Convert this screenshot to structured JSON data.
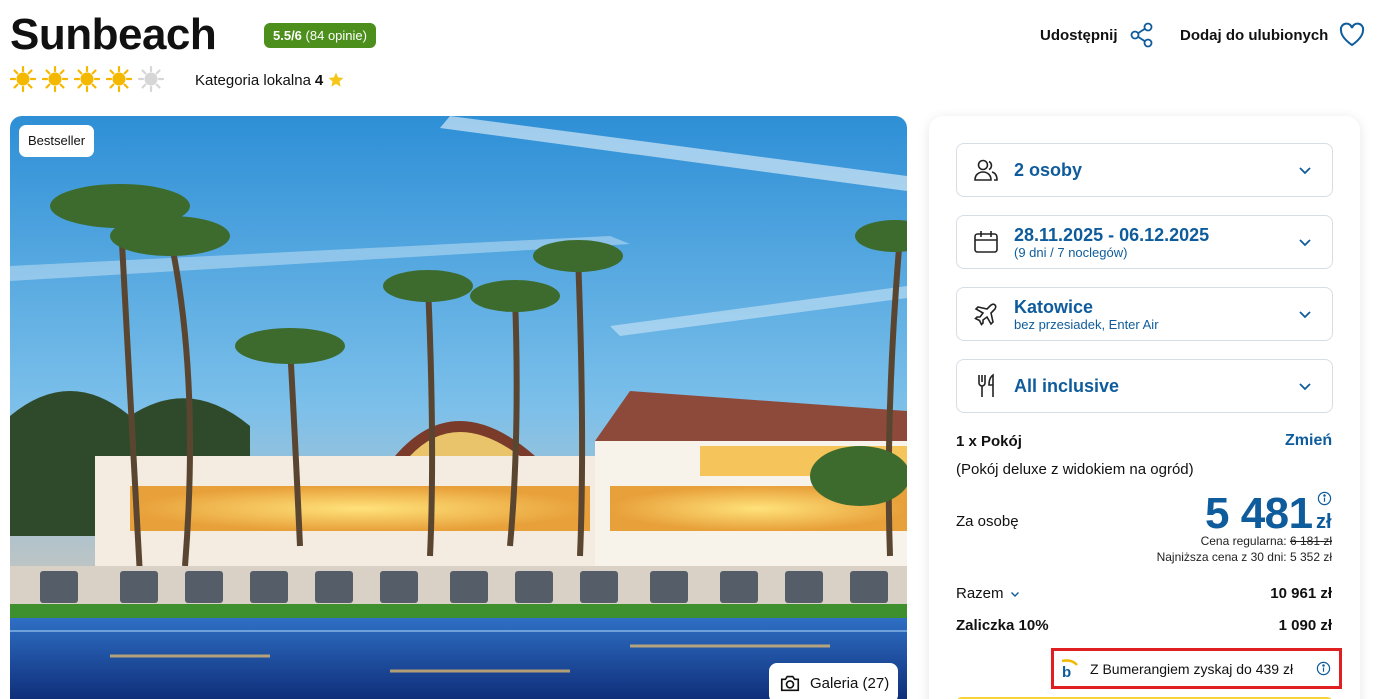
{
  "hotel": {
    "name": "Sunbeach",
    "rating_score": "5.5/6",
    "rating_reviews": "(84 opinie)",
    "suns_filled": 4,
    "suns_total": 5,
    "local_category_label": "Kategoria lokalna",
    "local_category_value": "4"
  },
  "header_actions": {
    "share_label": "Udostępnij",
    "favorite_label": "Dodaj do ulubionych"
  },
  "photo": {
    "badge": "Bestseller",
    "gallery_label": "Galeria (27)"
  },
  "booking": {
    "persons": {
      "main": "2 osoby"
    },
    "dates": {
      "main": "28.11.2025 - 06.12.2025",
      "sub": "(9 dni / 7 noclegów)"
    },
    "departure": {
      "main": "Katowice",
      "sub": "bez przesiadek, Enter Air"
    },
    "board": {
      "main": "All inclusive"
    },
    "room_qty": "1 x Pokój",
    "room_change": "Zmień",
    "room_type": "(Pokój deluxe z widokiem na ogród)",
    "per_person_label": "Za osobę",
    "price": "5 481",
    "currency": "zł",
    "regular_label": "Cena regularna:",
    "regular_price": "6 181 zł",
    "lowest_30": "Najniższa cena z 30 dni: 5 352 zł",
    "total_label": "Razem",
    "total_value": "10 961 zł",
    "deposit_label": "Zaliczka 10%",
    "deposit_value": "1 090 zł",
    "bumerang_text": "Z Bumerangiem zyskaj do 439 zł"
  },
  "colors": {
    "accent": "#0f5c9c",
    "rating_green": "#4d8f1d",
    "highlight_red": "#e02020",
    "cta_yellow": "#f7d33a",
    "sun_yellow": "#f5b800"
  }
}
